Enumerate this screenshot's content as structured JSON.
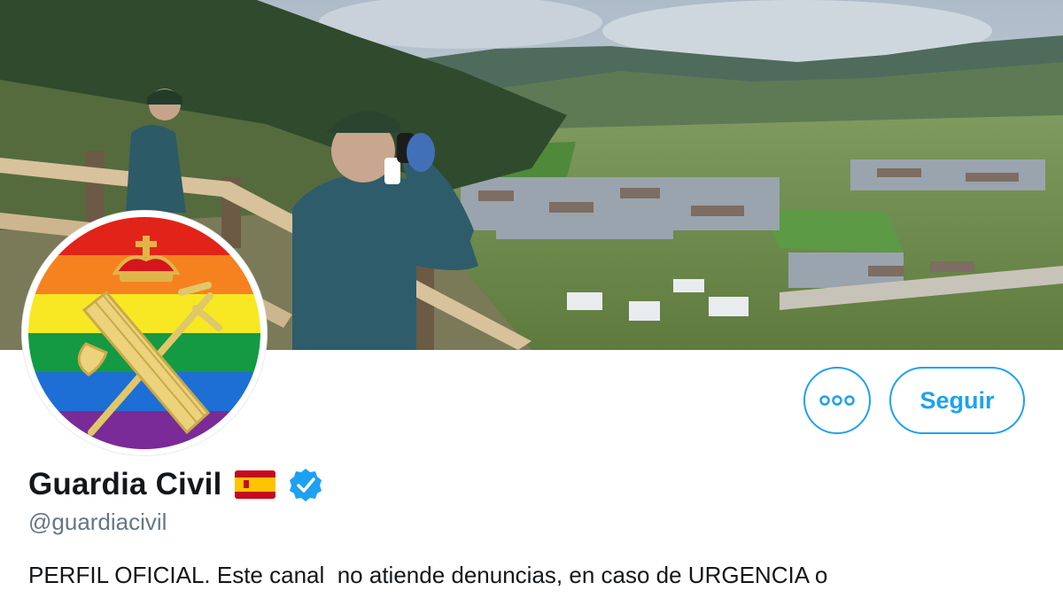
{
  "profile": {
    "display_name": "Guardia Civil",
    "handle": "@guardiacivil",
    "bio": "PERFIL OFICIAL. Este canal  no atiende denuncias, en caso de URGENCIA o",
    "flag_icon": "spain-flag-icon",
    "verified_icon": "verified-badge-icon"
  },
  "actions": {
    "follow_label": "Seguir",
    "more_icon": "more-options-icon"
  },
  "colors": {
    "accent": "#1da1f2",
    "text_primary": "#14171a",
    "text_secondary": "#657786"
  }
}
